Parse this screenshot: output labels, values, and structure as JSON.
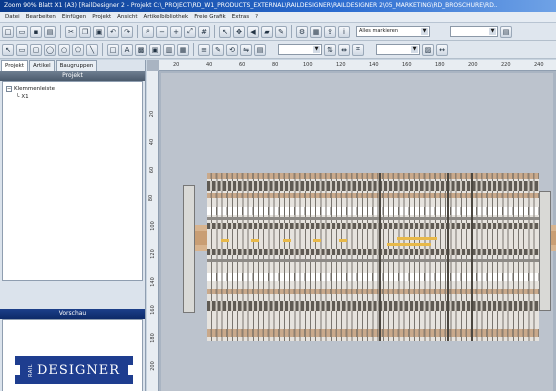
{
  "window": {
    "title": "Zoom 90%    Blatt X1 (A3)  [RailDesigner 2 - Projekt C:\\_PROJECT\\RD_W1_PRODUCTS_EXTERNAL\\RAILDESIGNER\\RAILDESIGNER 2\\05_MARKETING\\RD_BROSCHURE\\RD.."
  },
  "menu": [
    "Datei",
    "Bearbeiten",
    "Einfügen",
    "Projekt",
    "Ansicht",
    "Artikelbibliothek",
    "Freie Grafik",
    "Extras",
    "?"
  ],
  "toolbar": {
    "select_value": "Alles markieren"
  },
  "left": {
    "tabs": [
      "Projekt",
      "Artikel",
      "Baugruppen"
    ],
    "project_header": "Projekt",
    "tree_root": "Klemmenleiste",
    "tree_child": "X1",
    "preview_header": "Vorschau",
    "logo_rail": "RAIL",
    "logo_designer": "DESIGNER"
  },
  "ruler": {
    "top": [
      "20",
      "40",
      "60",
      "80",
      "100",
      "120",
      "140",
      "160",
      "180",
      "200",
      "220",
      "240"
    ],
    "left": [
      "20",
      "40",
      "60",
      "80",
      "100",
      "120",
      "140",
      "160",
      "180",
      "200",
      "220"
    ]
  },
  "colors": {
    "titlebar": "#0a3a8c",
    "rail": "#d8b48f",
    "label_marker": "#e8b94a"
  },
  "icons": [
    "new-icon",
    "open-icon",
    "save-icon",
    "print-icon",
    "cut-icon",
    "copy-icon",
    "paste-icon",
    "undo-icon",
    "redo-icon",
    "zoom-icon",
    "pointer-icon",
    "rectangle-icon",
    "ellipse-icon",
    "line-icon",
    "text-icon"
  ]
}
